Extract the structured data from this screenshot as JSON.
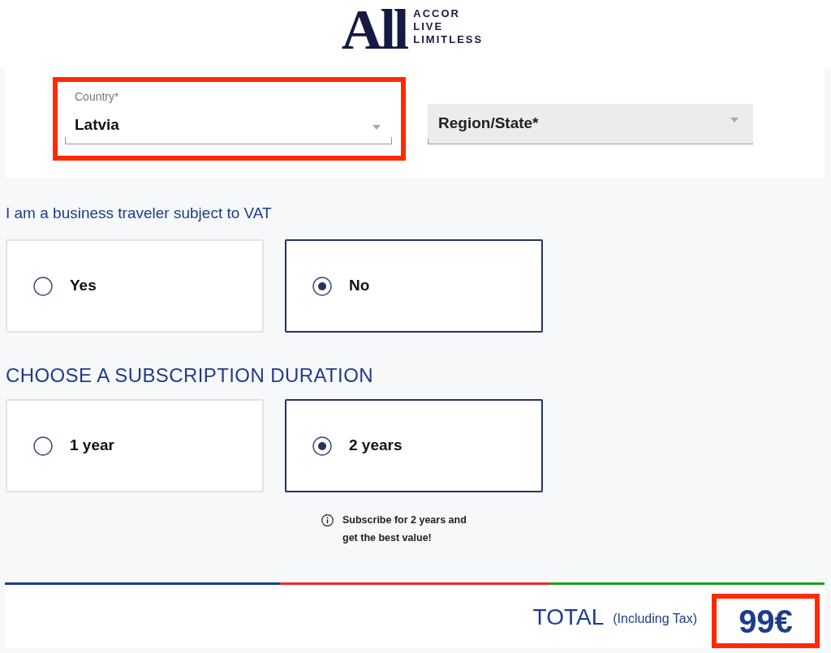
{
  "logo": {
    "mark": "All",
    "lines": [
      "ACCOR",
      "LIVE",
      "LIMITLESS"
    ]
  },
  "address": {
    "country": {
      "label": "Country*",
      "value": "Latvia",
      "highlighted": true
    },
    "region": {
      "placeholder": "Region/State*"
    }
  },
  "vat": {
    "title": "I am a business traveler subject to VAT",
    "options": [
      {
        "label": "Yes",
        "selected": false
      },
      {
        "label": "No",
        "selected": true
      }
    ]
  },
  "duration": {
    "title": "CHOOSE A SUBSCRIPTION DURATION",
    "options": [
      {
        "label": "1 year",
        "selected": false
      },
      {
        "label": "2 years",
        "selected": true
      }
    ],
    "note": {
      "lines": [
        "Subscribe for 2 years and",
        "get the best value!"
      ]
    }
  },
  "total": {
    "label": "TOTAL",
    "note": "(Including Tax)",
    "amount": "99€",
    "highlighted": true
  }
}
